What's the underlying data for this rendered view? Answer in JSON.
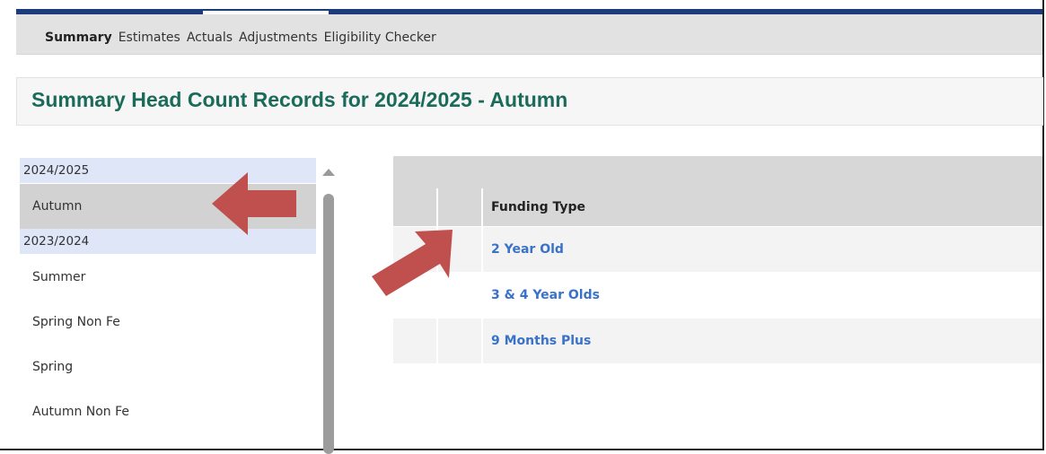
{
  "tabs": [
    "Summary",
    "Estimates",
    "Actuals",
    "Adjustments",
    "Eligibility Checker"
  ],
  "page_title": "Summary Head Count Records for 2024/2025 - Autumn",
  "sidebar": {
    "groups": [
      {
        "year": "2024/2025",
        "terms": [
          "Autumn"
        ]
      },
      {
        "year": "2023/2024",
        "terms": [
          "Summer",
          "Spring Non Fe",
          "Spring",
          "Autumn Non Fe"
        ]
      }
    ],
    "selected_term": "Autumn"
  },
  "table": {
    "column_header": "Funding Type",
    "rows": [
      "2 Year Old",
      "3 & 4 Year Olds",
      "9 Months Plus"
    ]
  },
  "colors": {
    "accent_title": "#1a6b5a",
    "link": "#3a72c9",
    "annotation_arrow": "#c0504d",
    "nav_bar": "#1d3a7c"
  }
}
